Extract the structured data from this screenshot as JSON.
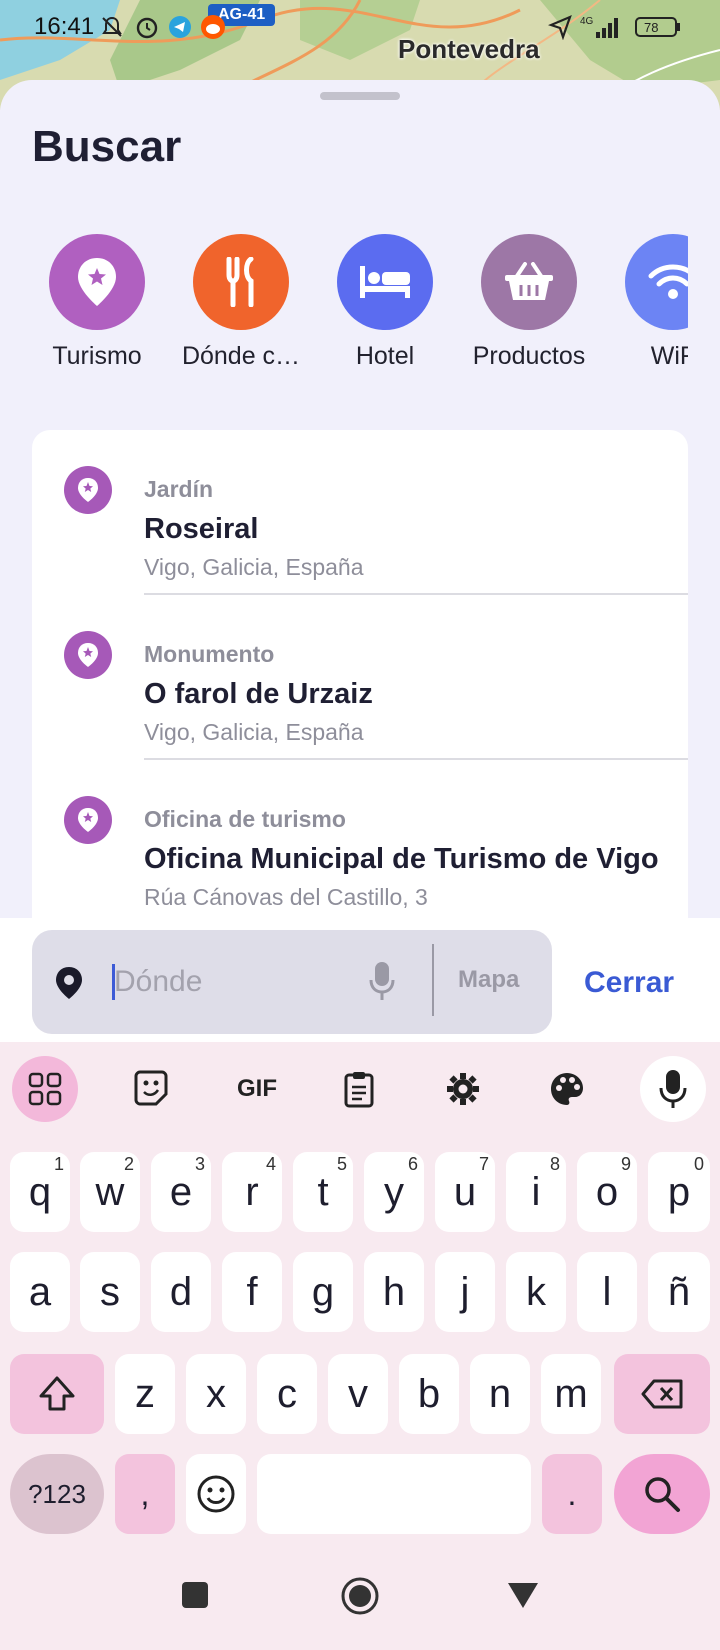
{
  "status": {
    "time": "16:41",
    "road_badge": "AG-41",
    "battery": "78",
    "network": "4G",
    "icons": [
      "bell-off-icon",
      "alarm-icon",
      "telegram-icon",
      "reddit-icon",
      "location-arrow-icon",
      "signal-icon",
      "battery-icon"
    ]
  },
  "map": {
    "label": "Pontevedra"
  },
  "sheet": {
    "title": "Buscar",
    "categories": [
      {
        "label": "Turismo",
        "icon": "tourism-pin-icon",
        "color": "#b060c0"
      },
      {
        "label": "Dónde c…",
        "icon": "fork-knife-icon",
        "color": "#f0642c"
      },
      {
        "label": "Hotel",
        "icon": "bed-icon",
        "color": "#5b6cf0"
      },
      {
        "label": "Productos",
        "icon": "basket-icon",
        "color": "#9d77a6"
      },
      {
        "label": "WiF",
        "icon": "wifi-icon",
        "color": "#6c84f4"
      }
    ],
    "results": [
      {
        "category": "Jardín",
        "name": "Roseiral",
        "address": "Vigo, Galicia, España"
      },
      {
        "category": "Monumento",
        "name": "O farol de Urzaiz",
        "address": "Vigo, Galicia, España"
      },
      {
        "category": "Oficina de turismo",
        "name": "Oficina Municipal de Turismo de Vigo",
        "address": "Rúa Cánovas del Castillo, 3"
      }
    ]
  },
  "search": {
    "placeholder": "Dónde",
    "value": "",
    "map_button": "Mapa",
    "close_button": "Cerrar"
  },
  "keyboard": {
    "row1": [
      {
        "key": "q",
        "num": "1"
      },
      {
        "key": "w",
        "num": "2"
      },
      {
        "key": "e",
        "num": "3"
      },
      {
        "key": "r",
        "num": "4"
      },
      {
        "key": "t",
        "num": "5"
      },
      {
        "key": "y",
        "num": "6"
      },
      {
        "key": "u",
        "num": "7"
      },
      {
        "key": "i",
        "num": "8"
      },
      {
        "key": "o",
        "num": "9"
      },
      {
        "key": "p",
        "num": "0"
      }
    ],
    "row2": [
      "a",
      "s",
      "d",
      "f",
      "g",
      "h",
      "j",
      "k",
      "l",
      "ñ"
    ],
    "row3": [
      "z",
      "x",
      "c",
      "v",
      "b",
      "n",
      "m"
    ],
    "symbols_key": "?123",
    "comma_key": ",",
    "period_key": ".",
    "toolbar": [
      "apps-grid-icon",
      "sticker-icon",
      "gif-icon",
      "clipboard-icon",
      "settings-icon",
      "palette-icon",
      "microphone-icon"
    ],
    "gif_label": "GIF"
  }
}
